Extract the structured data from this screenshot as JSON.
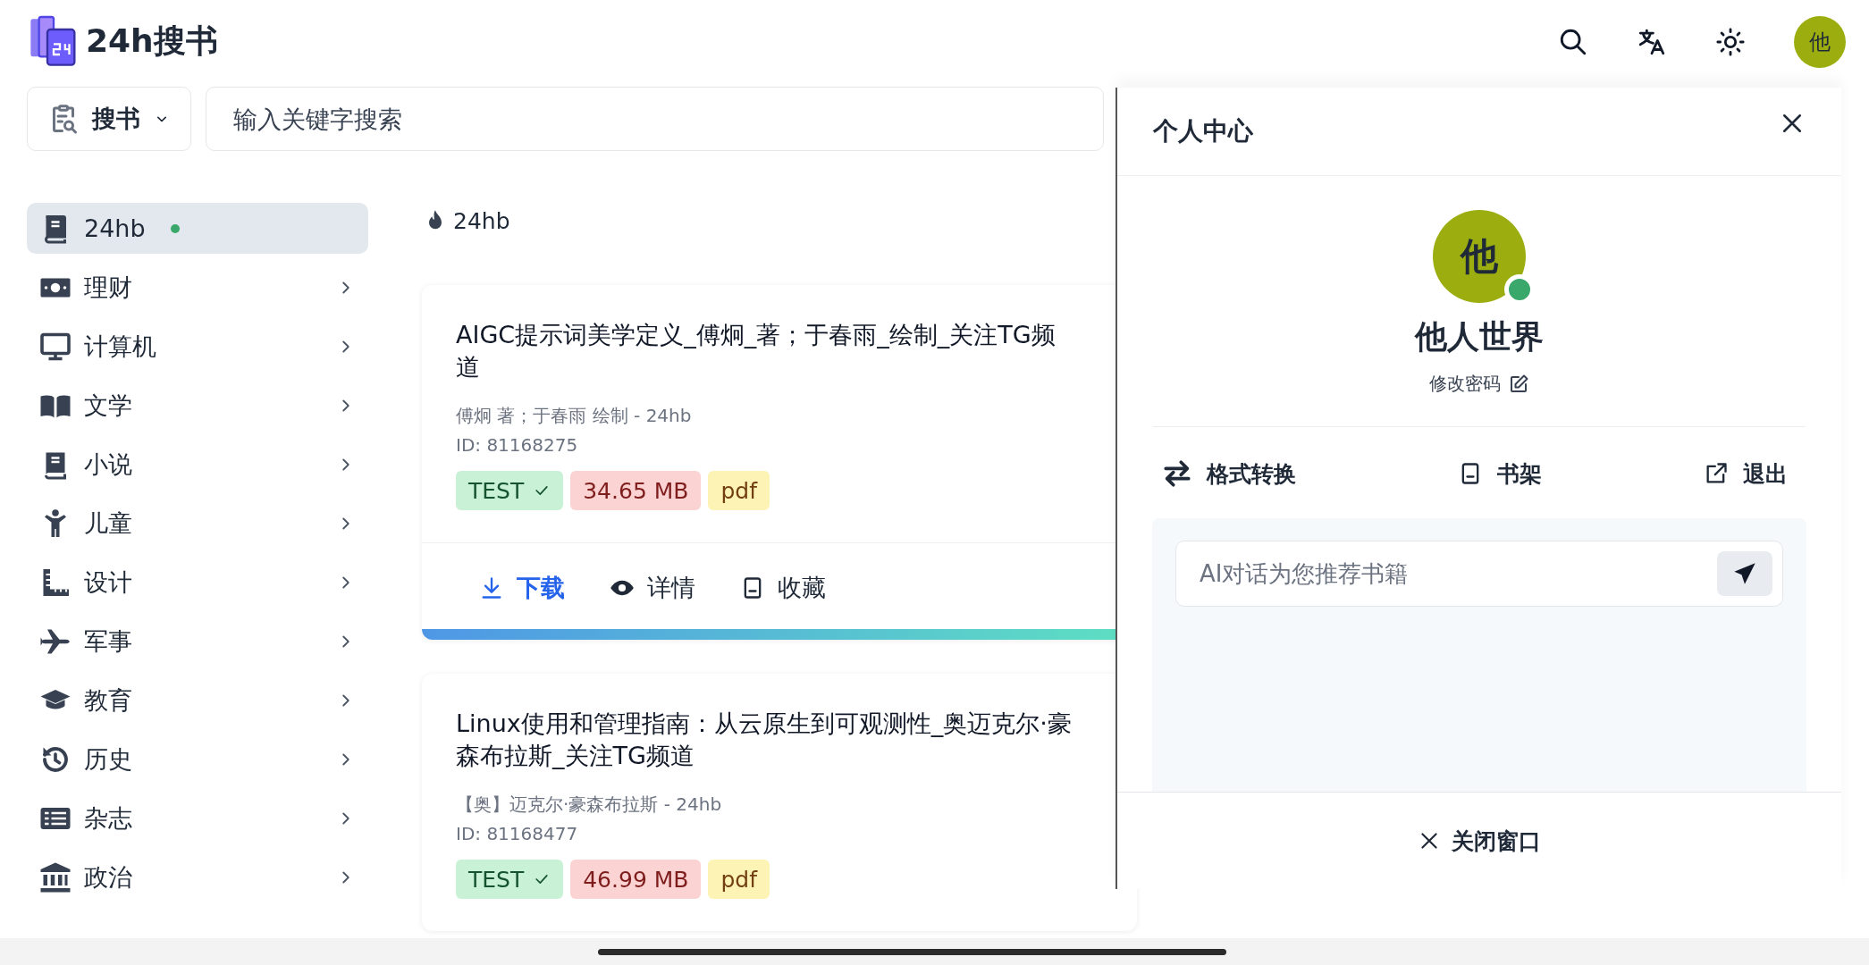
{
  "header": {
    "logo_text": "24h搜书",
    "avatar_text": "他"
  },
  "search": {
    "scope_label": "搜书",
    "placeholder": "输入关键字搜索"
  },
  "sidebar": {
    "items": [
      {
        "label": "24hb",
        "selected": true,
        "dot": true,
        "has_submenu": false
      },
      {
        "label": "理财",
        "selected": false,
        "dot": false,
        "has_submenu": true
      },
      {
        "label": "计算机",
        "selected": false,
        "dot": false,
        "has_submenu": true
      },
      {
        "label": "文学",
        "selected": false,
        "dot": false,
        "has_submenu": true
      },
      {
        "label": "小说",
        "selected": false,
        "dot": false,
        "has_submenu": true
      },
      {
        "label": "儿童",
        "selected": false,
        "dot": false,
        "has_submenu": true
      },
      {
        "label": "设计",
        "selected": false,
        "dot": false,
        "has_submenu": true
      },
      {
        "label": "军事",
        "selected": false,
        "dot": false,
        "has_submenu": true
      },
      {
        "label": "教育",
        "selected": false,
        "dot": false,
        "has_submenu": true
      },
      {
        "label": "历史",
        "selected": false,
        "dot": false,
        "has_submenu": true
      },
      {
        "label": "杂志",
        "selected": false,
        "dot": false,
        "has_submenu": true
      },
      {
        "label": "政治",
        "selected": false,
        "dot": false,
        "has_submenu": true
      }
    ]
  },
  "feed": {
    "section_title": "24hb",
    "cards": [
      {
        "title": "AIGC提示词美学定义_傅炯_著；于春雨_绘制_关注TG频道",
        "author_line": "傅炯 著；于春雨 绘制 - 24hb",
        "id": "ID: 81168275",
        "tags": [
          {
            "label": "TEST",
            "kind": "status"
          },
          {
            "label": "34.65 MB",
            "kind": "size"
          },
          {
            "label": "pdf",
            "kind": "format"
          }
        ],
        "actions": [
          {
            "label": "下载",
            "kind": "download",
            "primary": true
          },
          {
            "label": "详情",
            "kind": "details",
            "primary": false
          },
          {
            "label": "收藏",
            "kind": "bookmark",
            "primary": false
          }
        ]
      },
      {
        "title": "Linux使用和管理指南：从云原生到可观测性_奥迈克尔·豪森布拉斯_关注TG频道",
        "author_line": "【奥】迈克尔·豪森布拉斯 - 24hb",
        "id": "ID: 81168477",
        "tags": [
          {
            "label": "TEST",
            "kind": "status"
          },
          {
            "label": "46.99 MB",
            "kind": "size"
          },
          {
            "label": "pdf",
            "kind": "format"
          }
        ]
      }
    ]
  },
  "panel": {
    "title": "个人中心",
    "avatar_text": "他",
    "online": true,
    "user_name": "他人世界",
    "change_password": "修改密码",
    "actions": [
      {
        "label": "格式转换",
        "kind": "convert"
      },
      {
        "label": "书架",
        "kind": "shelf"
      },
      {
        "label": "退出",
        "kind": "logout"
      }
    ],
    "chat": {
      "placeholder": "AI对话为您推荐书籍"
    },
    "footer_button": "关闭窗口"
  }
}
